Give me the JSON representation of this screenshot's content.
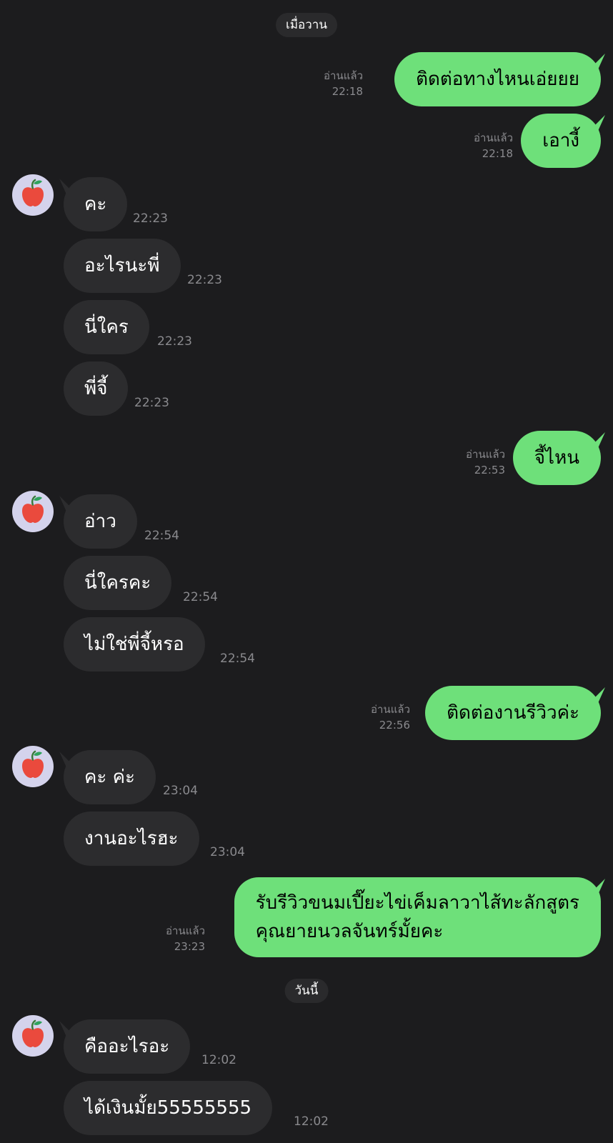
{
  "date_separators": [
    "เมื่อวาน",
    "วันนี้"
  ],
  "read_label": "อ่านแล้ว",
  "colors": {
    "background": "#1c1c1e",
    "outgoing_bubble": "#6ee07a",
    "incoming_bubble": "#2c2c2e",
    "avatar_bg": "#d4d3ec",
    "avatar_icon": "apple-icon"
  },
  "messages": [
    {
      "dir": "out",
      "text": "ติดต่อทางไหนเอ่ยยย",
      "status": "อ่านแล้ว",
      "time": "22:18"
    },
    {
      "dir": "out",
      "text": "เอางี้",
      "status": "อ่านแล้ว",
      "time": "22:18"
    },
    {
      "dir": "in",
      "text": "คะ",
      "time": "22:23"
    },
    {
      "dir": "in",
      "text": "อะไรนะพี่",
      "time": "22:23"
    },
    {
      "dir": "in",
      "text": "นี่ใคร",
      "time": "22:23"
    },
    {
      "dir": "in",
      "text": "พี่จี้",
      "time": "22:23"
    },
    {
      "dir": "out",
      "text": "จี้ไหน",
      "status": "อ่านแล้ว",
      "time": "22:53"
    },
    {
      "dir": "in",
      "text": "อ่าว",
      "time": "22:54"
    },
    {
      "dir": "in",
      "text": "นี่ใครคะ",
      "time": "22:54"
    },
    {
      "dir": "in",
      "text": "ไม่ใช่พี่จี้หรอ",
      "time": "22:54"
    },
    {
      "dir": "out",
      "text": "ติดต่องานรีวิวค่ะ",
      "status": "อ่านแล้ว",
      "time": "22:56"
    },
    {
      "dir": "in",
      "text": "คะ ค่ะ",
      "time": "23:04"
    },
    {
      "dir": "in",
      "text": "งานอะไรฮะ",
      "time": "23:04"
    },
    {
      "dir": "out",
      "line1": "รับรีวิวขนมเปี๊ยะไข่เค็มลาวาไส้ทะลักสูตร",
      "line2": "คุณยายนวลจันทร์มั้ยคะ",
      "status": "อ่านแล้ว",
      "time": "23:23"
    },
    {
      "dir": "in",
      "text": "คืออะไรอะ",
      "time": "12:02"
    },
    {
      "dir": "in",
      "text": "ได้เงินมั้ย55555555",
      "time": "12:02"
    }
  ]
}
